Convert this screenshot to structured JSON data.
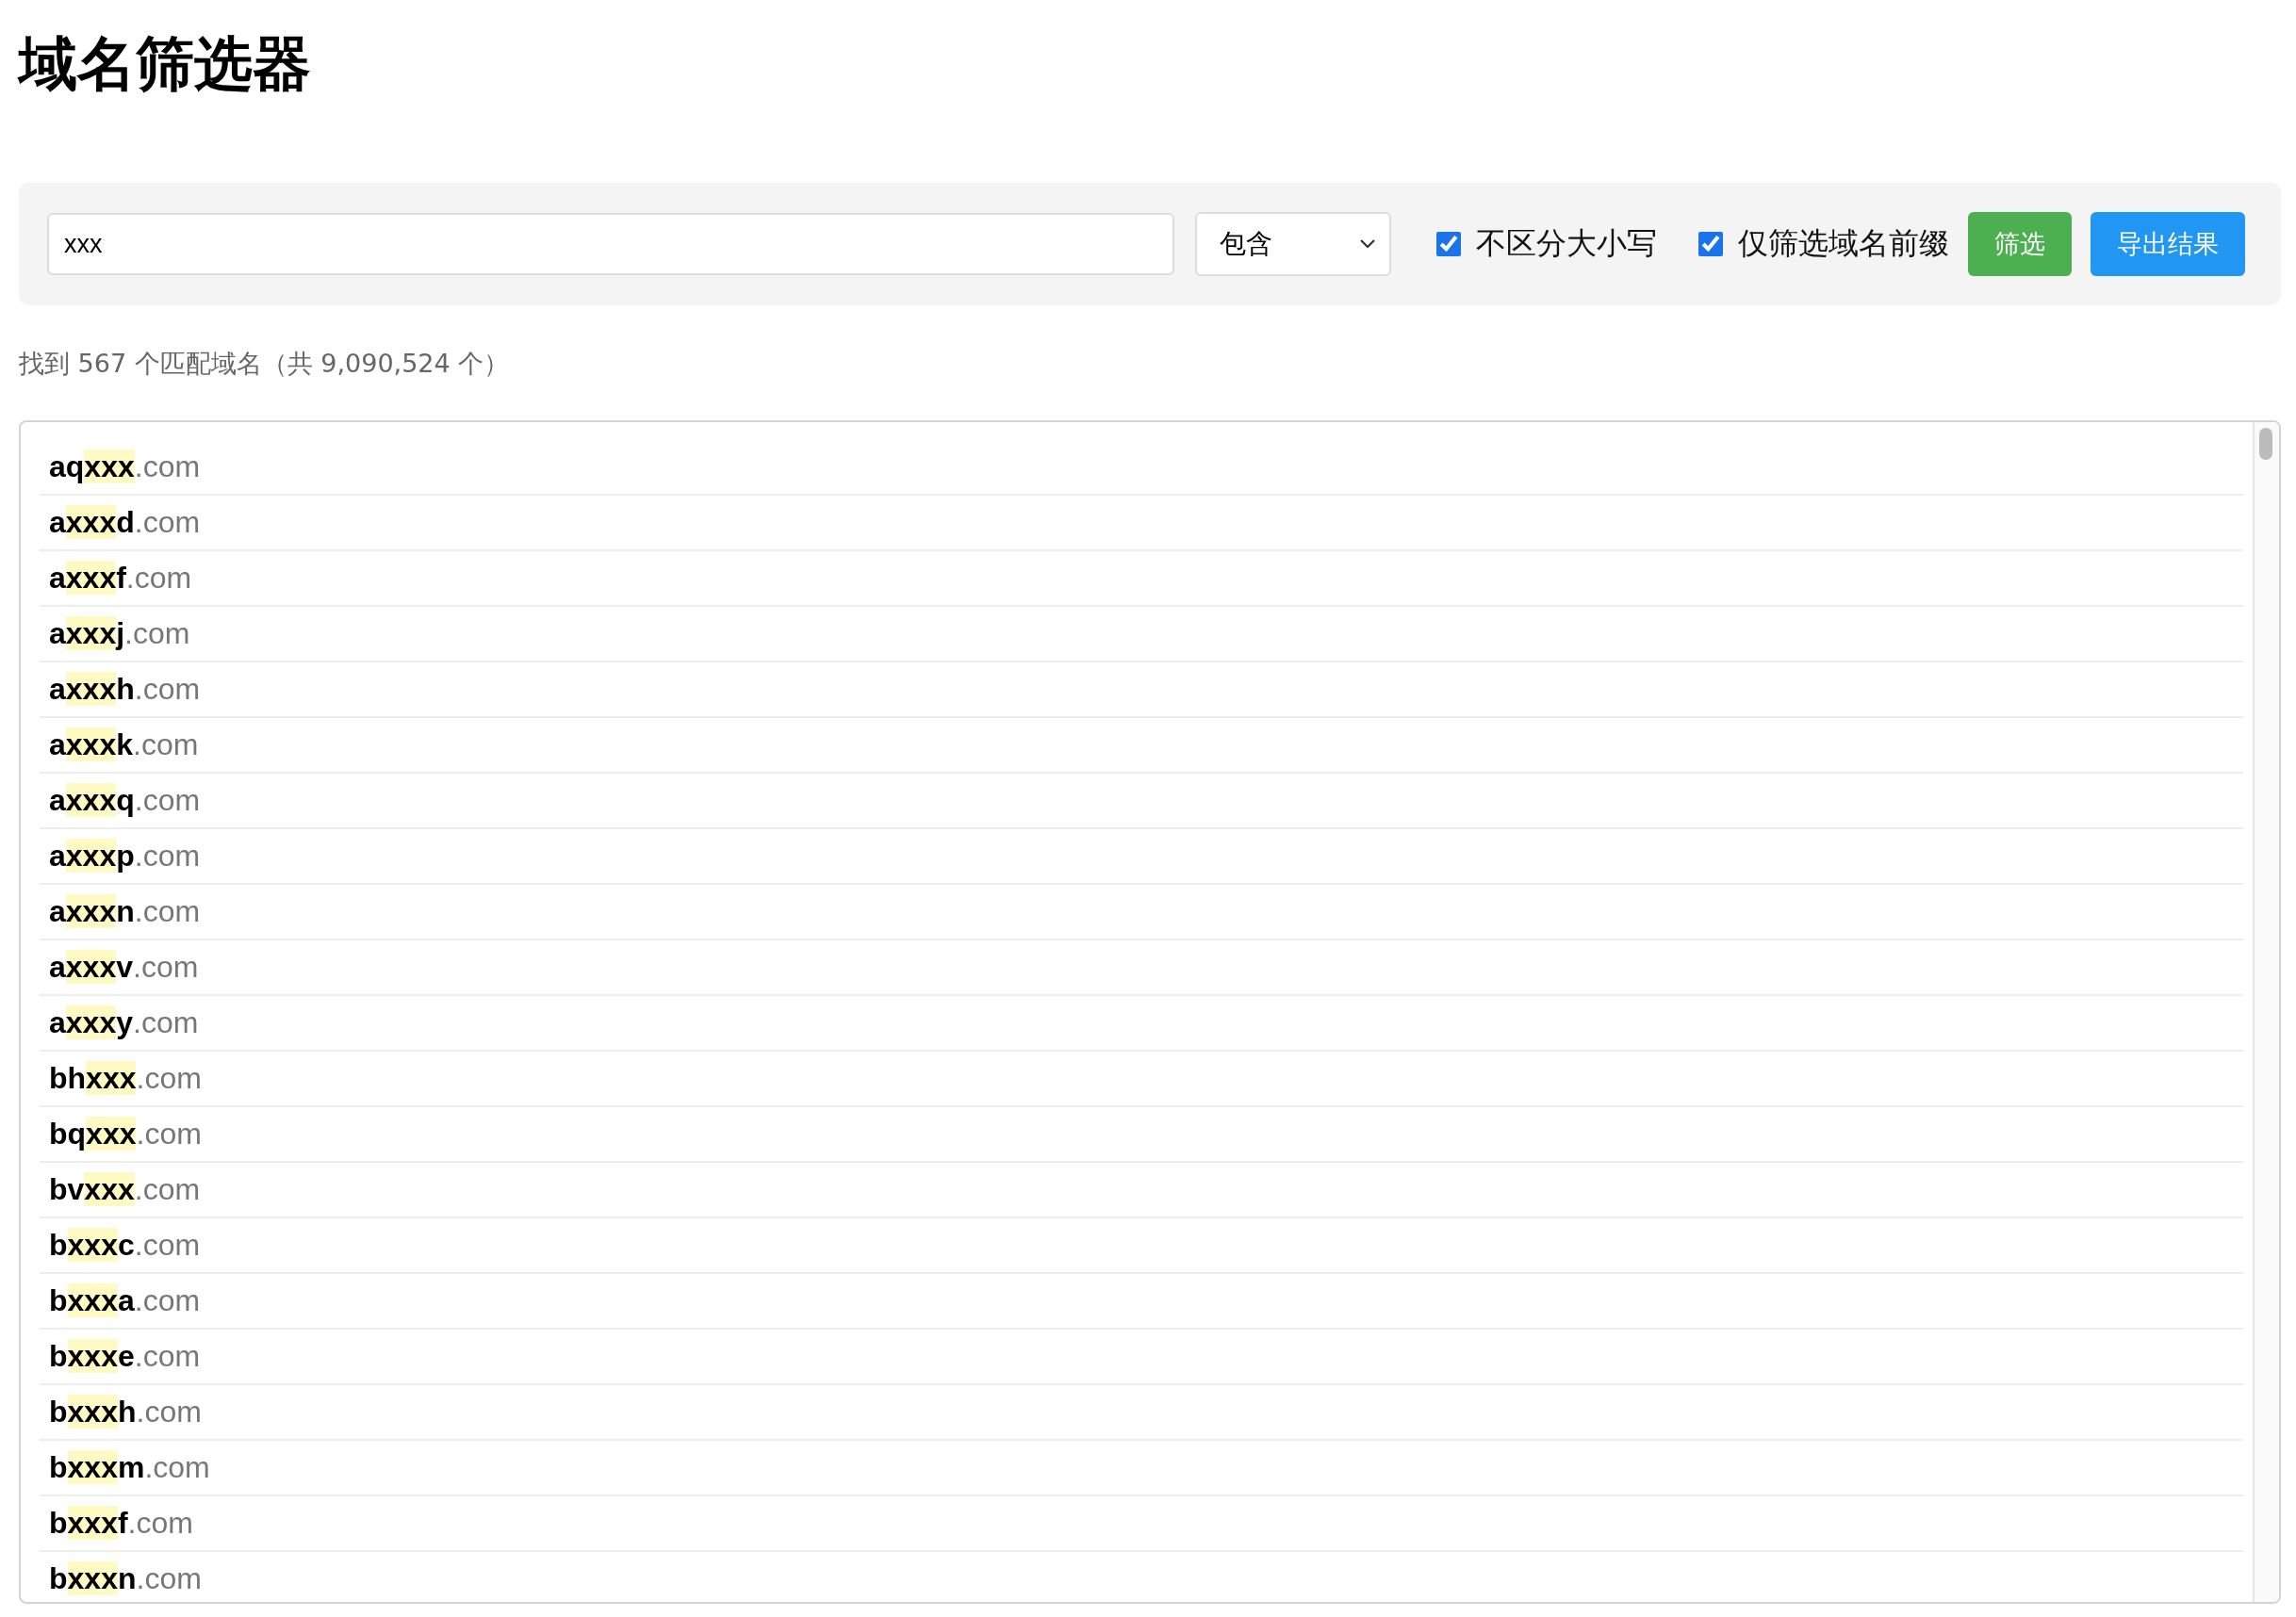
{
  "title": "域名筛选器",
  "search": {
    "value": "xxx"
  },
  "match_mode": {
    "value": "包含"
  },
  "options": [
    {
      "label": "不区分大小写",
      "checked": true
    },
    {
      "label": "仅筛选域名前缀",
      "checked": true
    }
  ],
  "buttons": [
    {
      "label": "筛选",
      "kind": "primary"
    },
    {
      "label": "导出结果",
      "kind": "export"
    }
  ],
  "summary": "找到 567 个匹配域名（共 9,090,524 个）",
  "results": [
    {
      "before": "aq",
      "match": "xxx",
      "tld": ".com"
    },
    {
      "before": "a",
      "match": "xxx",
      "after": "d",
      "tld": ".com"
    },
    {
      "before": "a",
      "match": "xxx",
      "after": "f",
      "tld": ".com"
    },
    {
      "before": "a",
      "match": "xxx",
      "after": "j",
      "tld": ".com"
    },
    {
      "before": "a",
      "match": "xxx",
      "after": "h",
      "tld": ".com"
    },
    {
      "before": "a",
      "match": "xxx",
      "after": "k",
      "tld": ".com"
    },
    {
      "before": "a",
      "match": "xxx",
      "after": "q",
      "tld": ".com"
    },
    {
      "before": "a",
      "match": "xxx",
      "after": "p",
      "tld": ".com"
    },
    {
      "before": "a",
      "match": "xxx",
      "after": "n",
      "tld": ".com"
    },
    {
      "before": "a",
      "match": "xxx",
      "after": "v",
      "tld": ".com"
    },
    {
      "before": "a",
      "match": "xxx",
      "after": "y",
      "tld": ".com"
    },
    {
      "before": "bh",
      "match": "xxx",
      "tld": ".com"
    },
    {
      "before": "bq",
      "match": "xxx",
      "tld": ".com"
    },
    {
      "before": "bv",
      "match": "xxx",
      "tld": ".com"
    },
    {
      "before": "b",
      "match": "xxx",
      "after": "c",
      "tld": ".com"
    },
    {
      "before": "b",
      "match": "xxx",
      "after": "a",
      "tld": ".com"
    },
    {
      "before": "b",
      "match": "xxx",
      "after": "e",
      "tld": ".com"
    },
    {
      "before": "b",
      "match": "xxx",
      "after": "h",
      "tld": ".com"
    },
    {
      "before": "b",
      "match": "xxx",
      "after": "m",
      "tld": ".com"
    },
    {
      "before": "b",
      "match": "xxx",
      "after": "f",
      "tld": ".com"
    },
    {
      "before": "b",
      "match": "xxx",
      "after": "n",
      "tld": ".com"
    }
  ]
}
